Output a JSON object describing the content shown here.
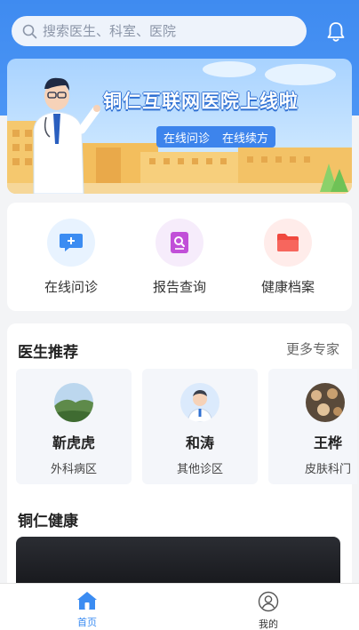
{
  "search": {
    "placeholder": "搜索医生、科室、医院"
  },
  "banner": {
    "title": "铜仁互联网医院上线啦",
    "tags": [
      "在线问诊",
      "在线续方"
    ]
  },
  "services": [
    {
      "label": "在线问诊",
      "icon": "chat-bubble-plus-icon",
      "color": "#3b8cf2",
      "bg": "#e8f3ff"
    },
    {
      "label": "报告查询",
      "icon": "report-search-icon",
      "color": "#c14fd8",
      "bg": "#f6ecfb"
    },
    {
      "label": "健康档案",
      "icon": "folder-icon",
      "color": "#f0483e",
      "bg": "#ffecea"
    }
  ],
  "doctors_section": {
    "title": "医生推荐",
    "more_label": "更多专家",
    "items": [
      {
        "name": "靳虎虎",
        "dept": "外科病区"
      },
      {
        "name": "和涛",
        "dept": "其他诊区"
      },
      {
        "name": "王桦",
        "dept": "皮肤科门"
      }
    ]
  },
  "health_section": {
    "title": "铜仁健康"
  },
  "tabbar": {
    "items": [
      {
        "label": "首页",
        "active": true
      },
      {
        "label": "我的",
        "active": false
      }
    ],
    "active_color": "#3b8cf2",
    "inactive_color": "#333333"
  }
}
